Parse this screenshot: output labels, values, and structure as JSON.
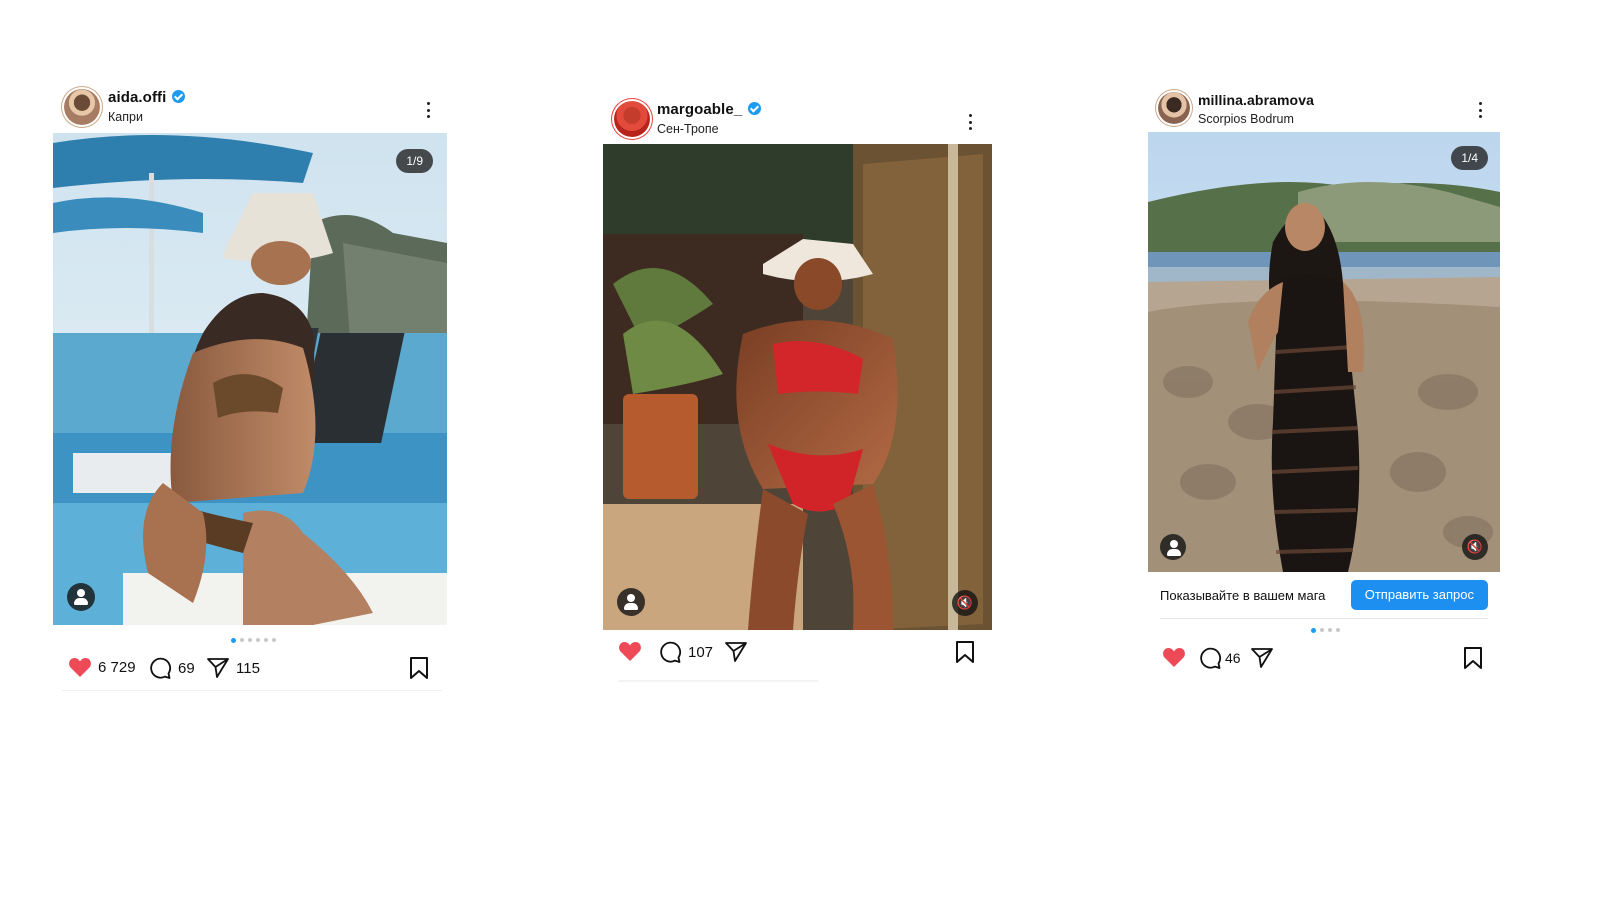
{
  "posts": [
    {
      "username": "aida.offi",
      "location": "Капри",
      "counter": "1/9",
      "likes": "6 729",
      "comments": "69",
      "shares": "115"
    },
    {
      "username": "margoable_",
      "location": "Сен-Тропе",
      "comments": "107"
    },
    {
      "username": "millina.abramova",
      "location": "Scorpios Bodrum",
      "counter": "1/4",
      "comments": "46",
      "promo_text": "Показывайте в вашем мага",
      "promo_button": "Отправить запрос"
    }
  ],
  "colors": {
    "like_red": "#ed4956",
    "accent_blue": "#1d8ff0",
    "verified_blue": "#1d9bf0"
  },
  "icons": [
    "heart-icon",
    "comment-icon",
    "share-icon",
    "bookmark-icon",
    "kebab-icon",
    "verified-icon",
    "user-tag-icon",
    "mute-icon"
  ]
}
